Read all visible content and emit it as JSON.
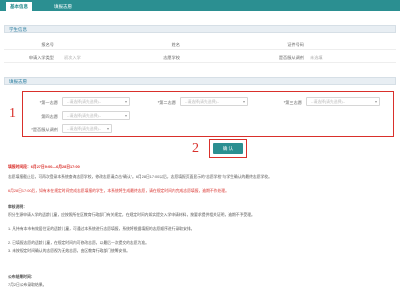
{
  "tabs": [
    "基本信息",
    "填报志愿"
  ],
  "sections": {
    "student_info": "学生信息",
    "choices": "填报志愿"
  },
  "student": {
    "labels": [
      "报名号",
      "姓名",
      "证件号码",
      "申请入学类型",
      "志愿学校",
      "是否服从调剂"
    ],
    "values": [
      "",
      "",
      "",
      "初次入学",
      "",
      "未选填"
    ]
  },
  "choices": {
    "labels": [
      "*第一志愿",
      "*第二志愿",
      "*第三志愿",
      "第四志愿",
      "*是否服从调剂"
    ],
    "placeholder": "--请选择(请先选择)--"
  },
  "annotations": [
    "1",
    "2"
  ],
  "confirm_label": "确 认",
  "notice_header": "填报时间段：6月27日9:00—6月28日17:00",
  "paragraphs": [
    "志愿填报截止后，可再次登录本系统查询志愿学校，修改志愿请点击“确认”。6月28日17:00以后，志愿填报页面显示的“志愿学校”与学生确认的最终志愿学校。",
    "6月28日17:00后，如有未在规定时间完成志愿填报的学生，本系统将生成最终志愿，请在规定时间内完成志愿填报，逾期不作处理。",
    "审核说明：",
    "积分生源申请入学的适龄儿童，应按照所在区教育行政部门有关规定，在规定时间内如实提交入学申请材料，按要求提供相关证明，逾期不予受理。",
    "1. 凡持有本市有效居住证的适龄儿童，可通过本系统进行志愿填报，系统将根据填报的志愿顺序进行录取安排。",
    "2. 已填报志愿的适龄儿童，在规定时间内可修改志愿，以最后一次提交的志愿为准。",
    "3. 未按规定时间确认的志愿视为无效志愿，由区教育行政部门统筹安排。",
    "公布结果时间：",
    "7月2日公布录取结果。"
  ]
}
